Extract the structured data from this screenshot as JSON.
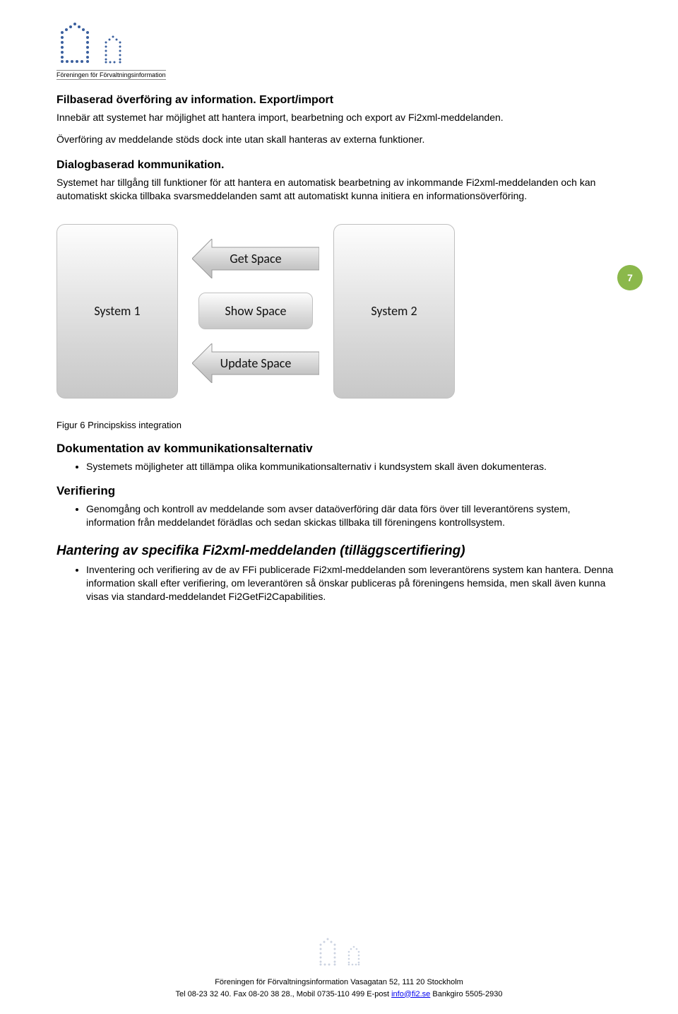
{
  "logo_caption": "Föreningen för Förvaltningsinformation",
  "section1": {
    "title": "Filbaserad överföring av information. Export/import",
    "p1": "Innebär att systemet har möjlighet att hantera import, bearbetning och export av Fi2xml-meddelanden.",
    "p2": "Överföring av meddelande stöds dock inte utan skall hanteras av externa funktioner."
  },
  "section2": {
    "title": "Dialogbaserad kommunikation.",
    "p1": "Systemet har tillgång till funktioner för att hantera en automatisk bearbetning av inkommande Fi2xml-meddelanden och kan automatiskt skicka tillbaka svarsmeddelanden samt att automatiskt kunna initiera en informationsöverföring."
  },
  "page_number": "7",
  "diagram": {
    "system1": "System 1",
    "system2": "System 2",
    "arrow_top": "Get Space",
    "arrow_mid": "Show Space",
    "arrow_bot": "Update Space",
    "caption": "Figur 6 Principskiss integration"
  },
  "section3": {
    "title": "Dokumentation av kommunikationsalternativ",
    "bullet1": "Systemets möjligheter att tillämpa olika kommunikationsalternativ i kundsystem skall även dokumenteras."
  },
  "section4": {
    "title": "Verifiering",
    "bullet1": "Genomgång och kontroll av meddelande som avser dataöverföring där data förs över till leverantörens system, information från meddelandet förädlas och sedan skickas tillbaka till föreningens kontrollsystem."
  },
  "section5": {
    "title": "Hantering av specifika Fi2xml-meddelanden (tilläggscertifiering)",
    "bullet1": "Inventering och verifiering av de av FFi publicerade Fi2xml-meddelanden som leverantörens system kan hantera. Denna information skall efter verifiering, om leverantören så önskar publiceras på föreningens hemsida, men skall även kunna visas via standard-meddelandet Fi2GetFi2Capabilities."
  },
  "footer": {
    "l1_prefix": "Föreningen för Förvaltningsinformation Vasagatan 52, 111 20 Stockholm",
    "l2_prefix": "Tel 08-23 32 40. Fax 08-20 38 28., Mobil 0735-110 499 E-post ",
    "email": "info@fi2.se",
    "l2_suffix": " Bankgiro 5505-2930"
  }
}
